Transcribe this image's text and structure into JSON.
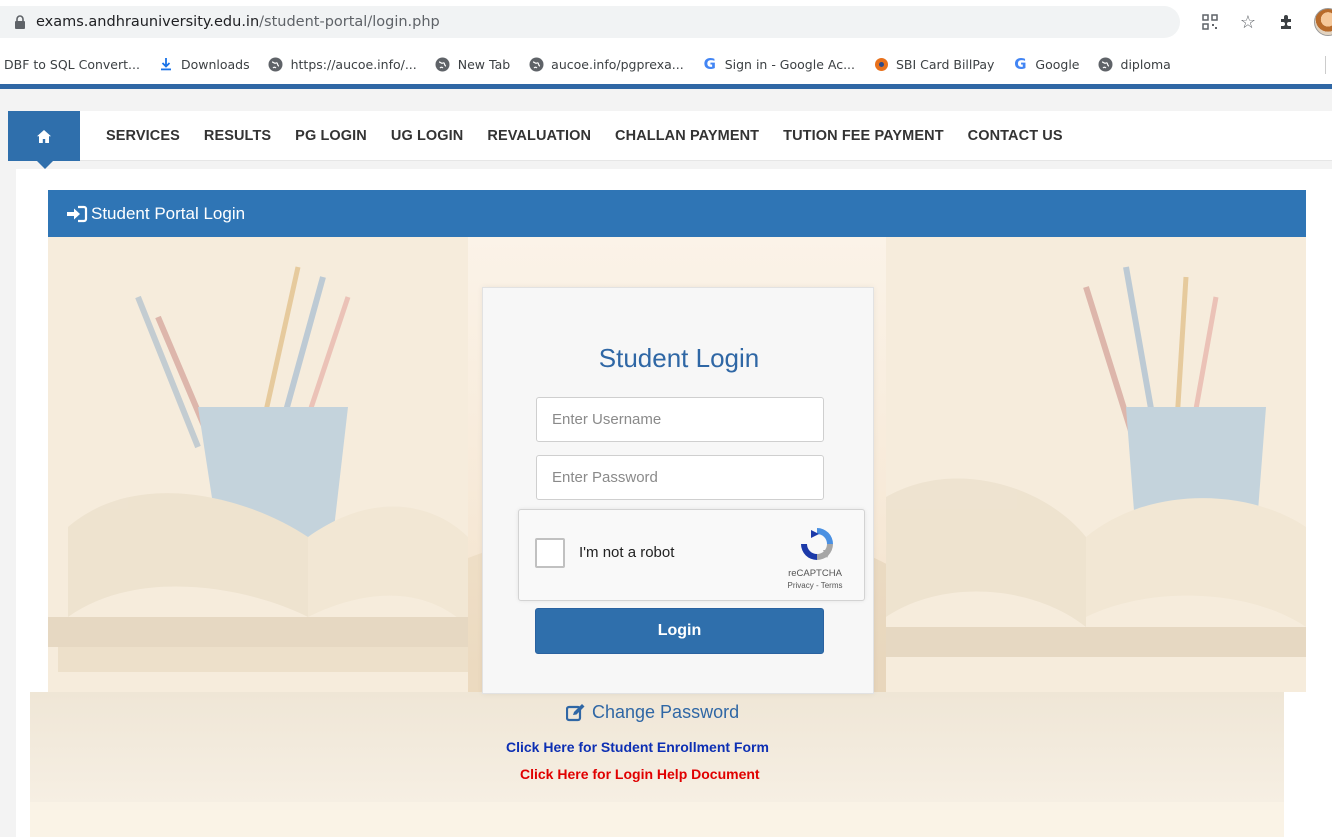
{
  "browser": {
    "url_host": "exams.andhrauniversity.edu.in",
    "url_path": "/student-portal/login.php"
  },
  "bookmarks": [
    {
      "label": "DBF to SQL Convert...",
      "icon": "none"
    },
    {
      "label": "Downloads",
      "icon": "download-icon"
    },
    {
      "label": "https://aucoe.info/...",
      "icon": "globe-icon"
    },
    {
      "label": "New Tab",
      "icon": "globe-icon"
    },
    {
      "label": "aucoe.info/pgprexa...",
      "icon": "globe-icon"
    },
    {
      "label": "Sign in - Google Ac...",
      "icon": "google-icon"
    },
    {
      "label": "SBI Card BillPay",
      "icon": "sbi-icon"
    },
    {
      "label": "Google",
      "icon": "google-icon"
    },
    {
      "label": "diploma",
      "icon": "globe-icon"
    }
  ],
  "nav": {
    "items": [
      "SERVICES",
      "RESULTS",
      "PG LOGIN",
      "UG LOGIN",
      "REVALUATION",
      "CHALLAN PAYMENT",
      "TUTION FEE PAYMENT",
      "CONTACT US"
    ]
  },
  "panel": {
    "title": "Student Portal Login"
  },
  "login": {
    "title": "Student Login",
    "username_placeholder": "Enter Username",
    "username_value": "",
    "password_placeholder": "Enter Password",
    "password_value": "",
    "captcha_label": "I'm not a robot",
    "captcha_brand": "reCAPTCHA",
    "captcha_links": "Privacy - Terms",
    "button": "Login"
  },
  "links": {
    "change_password": "Change Password",
    "enrollment": "Click Here for Student Enrollment Form",
    "help": "Click Here for Login Help Document"
  },
  "colors": {
    "primary": "#2f6fac",
    "panel_header": "#2f75b5",
    "enroll_link": "#0d2fb3",
    "help_link": "#e00000"
  }
}
